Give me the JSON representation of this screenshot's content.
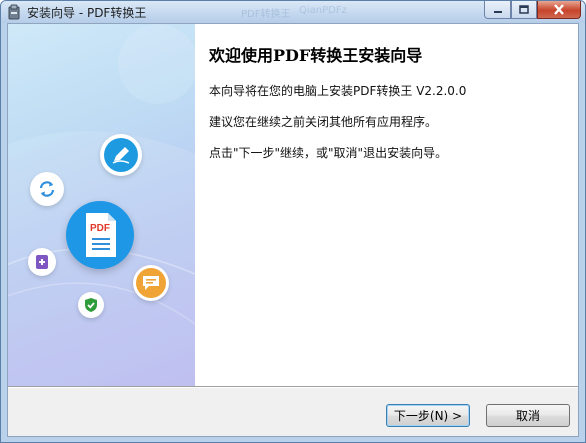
{
  "window": {
    "title": "安装向导 - PDF转换王",
    "ghost_title_1": "PDF转换王",
    "ghost_title_2": "QianPDFz"
  },
  "content": {
    "heading": "欢迎使用PDF转换王安装向导",
    "lines": [
      "本向导将在您的电脑上安装PDF转换王 V2.2.0.0",
      "建议您在继续之前关闭其他所有应用程序。",
      "点击\"下一步\"继续，或\"取消\"退出安装向导。"
    ]
  },
  "side": {
    "pdf_label": "PDF"
  },
  "buttons": {
    "next_label": "下一步(N) >",
    "cancel_label": "取消"
  },
  "colors": {
    "accent": "#2f8fdb",
    "pen_circle": "#1e9be0",
    "chat_circle": "#f1a436",
    "plus_square": "#7e57c2",
    "shield": "#2e9c3a"
  },
  "icons": [
    "app-icon",
    "minimize-icon",
    "maximize-icon",
    "close-icon",
    "pen-icon",
    "refresh-icon",
    "pdf-document-icon",
    "plus-icon",
    "chat-icon",
    "shield-icon"
  ]
}
